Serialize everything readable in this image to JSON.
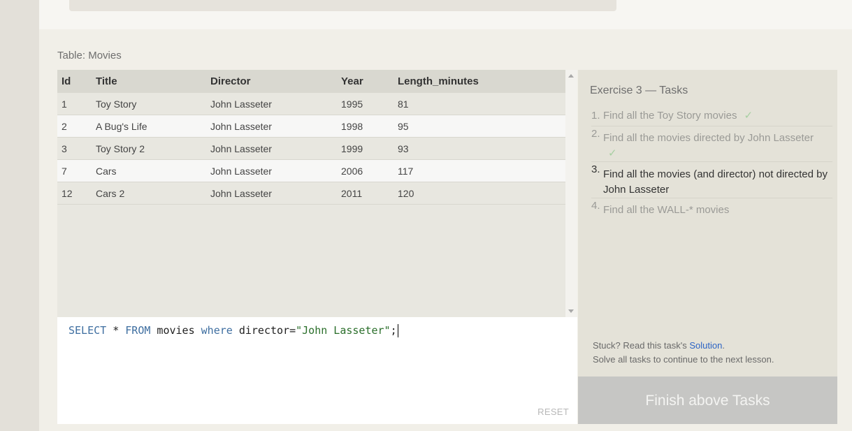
{
  "table": {
    "label": "Table: Movies",
    "headers": [
      "Id",
      "Title",
      "Director",
      "Year",
      "Length_minutes"
    ],
    "rows": [
      [
        "1",
        "Toy Story",
        "John Lasseter",
        "1995",
        "81"
      ],
      [
        "2",
        "A Bug's Life",
        "John Lasseter",
        "1998",
        "95"
      ],
      [
        "3",
        "Toy Story 2",
        "John Lasseter",
        "1999",
        "93"
      ],
      [
        "7",
        "Cars",
        "John Lasseter",
        "2006",
        "117"
      ],
      [
        "12",
        "Cars 2",
        "John Lasseter",
        "2011",
        "120"
      ]
    ]
  },
  "editor": {
    "query_tokens": [
      "SELECT",
      " * ",
      "FROM",
      " movies ",
      "where",
      " director=",
      "\"John Lasseter\"",
      ";"
    ],
    "reset_label": "RESET"
  },
  "tasks": {
    "title": "Exercise 3 — Tasks",
    "items": [
      {
        "num": "1.",
        "text": "Find all the Toy Story movies",
        "check": "✓",
        "status": "done"
      },
      {
        "num": "2.",
        "text": "Find all the movies directed by John Lasseter",
        "check": "✓",
        "status": "done"
      },
      {
        "num": "3.",
        "text": "Find all the movies (and director) not directed by John Lasseter",
        "check": "",
        "status": "active"
      },
      {
        "num": "4.",
        "text": "Find all the WALL-* movies",
        "check": "",
        "status": "pending"
      }
    ],
    "stuck_prefix": "Stuck? Read this task's ",
    "solution_link": "Solution",
    "stuck_suffix": ".",
    "continue_note": "Solve all tasks to continue to the next lesson."
  },
  "finish_button": "Finish above Tasks",
  "colors": {
    "keyword": "#3e6ea0",
    "string": "#2a6e2a",
    "link": "#2d64c4",
    "check": "#a7cfa2"
  }
}
